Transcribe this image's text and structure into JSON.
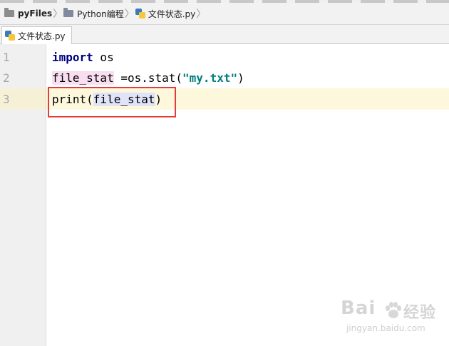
{
  "breadcrumb": {
    "root": "pyFiles",
    "folder": "Python编程",
    "file": "文件状态.py",
    "separator": "〉"
  },
  "tab": {
    "label": "文件状态.py"
  },
  "editor": {
    "line_numbers": [
      "1",
      "2",
      "3"
    ],
    "current_line": 3,
    "lines": [
      {
        "kw": "import",
        "rest": " os"
      },
      {
        "var": "file_stat",
        "rest": " =os.stat(",
        "str": "\"my.txt\"",
        "end": ")"
      },
      {
        "fn": "print(",
        "arg": "file_stat",
        "end": ")"
      }
    ]
  },
  "watermark": {
    "main": "Bai",
    "after": "经验",
    "sub": "jingyan.baidu.com"
  },
  "colors": {
    "keyword": "#000080",
    "string": "#008080",
    "highlight_box": "#e33c3c",
    "current_line": "#fdf8dc"
  }
}
